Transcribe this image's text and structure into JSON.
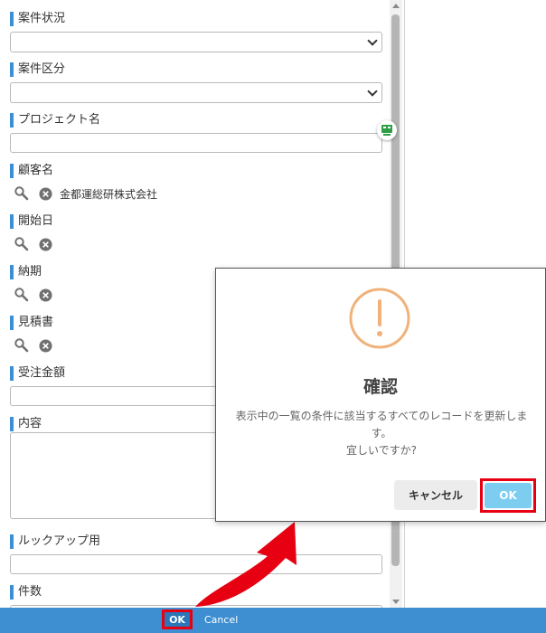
{
  "form": {
    "fields": [
      {
        "label": "案件状況",
        "type": "select",
        "value": ""
      },
      {
        "label": "案件区分",
        "type": "select",
        "value": ""
      },
      {
        "label": "プロジェクト名",
        "type": "text",
        "value": ""
      },
      {
        "label": "顧客名",
        "type": "lookup",
        "value": "金都運総研株式会社"
      },
      {
        "label": "開始日",
        "type": "lookup",
        "value": ""
      },
      {
        "label": "納期",
        "type": "lookup",
        "value": ""
      },
      {
        "label": "見積書",
        "type": "lookup",
        "value": ""
      },
      {
        "label": "受注金額",
        "type": "text",
        "value": ""
      },
      {
        "label": "内容",
        "type": "textarea",
        "value": ""
      },
      {
        "label": "ルックアップ用",
        "type": "text",
        "value": ""
      },
      {
        "label": "件数",
        "type": "text",
        "value": ""
      }
    ]
  },
  "footer": {
    "ok_label": "OK",
    "cancel_label": "Cancel"
  },
  "dialog": {
    "icon": "exclamation-circle-icon",
    "title": "確認",
    "message_line1": "表示中の一覧の条件に該当するすべてのレコードを更新しま",
    "message_line2": "す。",
    "message_line3": "宜しいですか?",
    "cancel_label": "キャンセル",
    "ok_label": "OK"
  },
  "colors": {
    "accent": "#3d8fd1",
    "label_bar": "#3a8fd6",
    "highlight": "#e60012",
    "warning_icon": "#f0b27a",
    "dialog_ok": "#7dcdf1",
    "float_icon": "#2f9e44"
  }
}
